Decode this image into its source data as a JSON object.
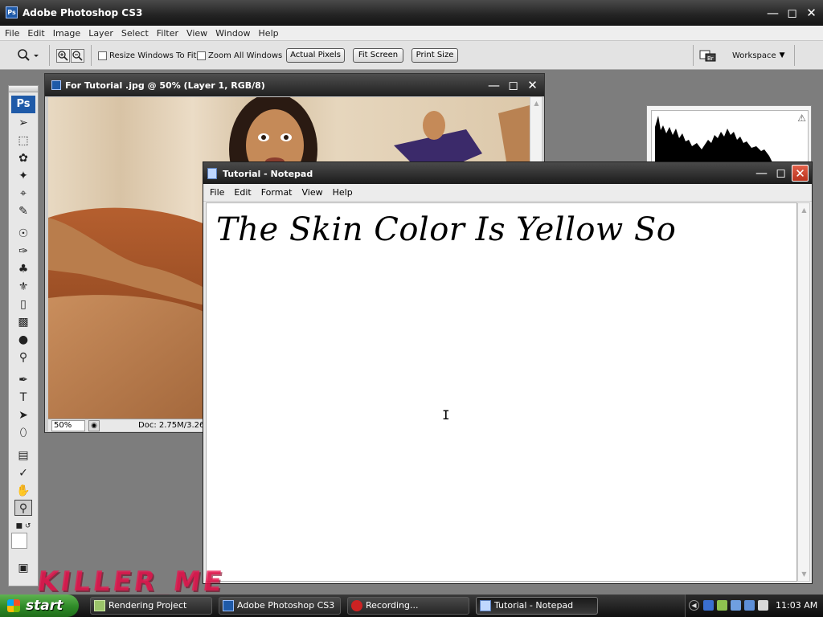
{
  "photoshop": {
    "app_title": "Adobe Photoshop CS3",
    "app_icon": "Ps",
    "menu": [
      "File",
      "Edit",
      "Image",
      "Layer",
      "Select",
      "Filter",
      "View",
      "Window",
      "Help"
    ],
    "options": {
      "resize_windows_label": "Resize Windows To Fit",
      "zoom_all_label": "Zoom All Windows",
      "actual_pixels": "Actual Pixels",
      "fit_screen": "Fit Screen",
      "print_size": "Print Size",
      "workspace": "Workspace"
    },
    "toolbox_logo": "Ps",
    "document": {
      "title": "For Tutorial .jpg @ 50% (Layer 1, RGB/8)",
      "zoom": "50%",
      "doc_info": "Doc: 2.75M/3.26M"
    }
  },
  "notepad": {
    "title": "Tutorial - Notepad",
    "menu": [
      "File",
      "Edit",
      "Format",
      "View",
      "Help"
    ],
    "content": "The Skin Color Is Yellow So"
  },
  "watermark": "KILLER_ME",
  "taskbar": {
    "start_label": "start",
    "tasks": [
      {
        "label": "Rendering Project"
      },
      {
        "label": "Adobe Photoshop CS3"
      },
      {
        "label": "Recording..."
      },
      {
        "label": "Tutorial - Notepad"
      }
    ],
    "clock": "11:03 AM"
  },
  "colors": {
    "workspace_bg": "#7d7d7d",
    "titlebar_dark": "#1b1b1b",
    "ps_blue": "#1f5aa8",
    "start_green": "#2e8a27",
    "close_red": "#c84a30",
    "watermark_pink": "#eb1450"
  },
  "icons": {
    "zoom_tool": "zoom-icon",
    "histogram_warning": "warning-icon",
    "bridge": "bridge-icon",
    "text_cursor": "i-beam-cursor-icon"
  }
}
